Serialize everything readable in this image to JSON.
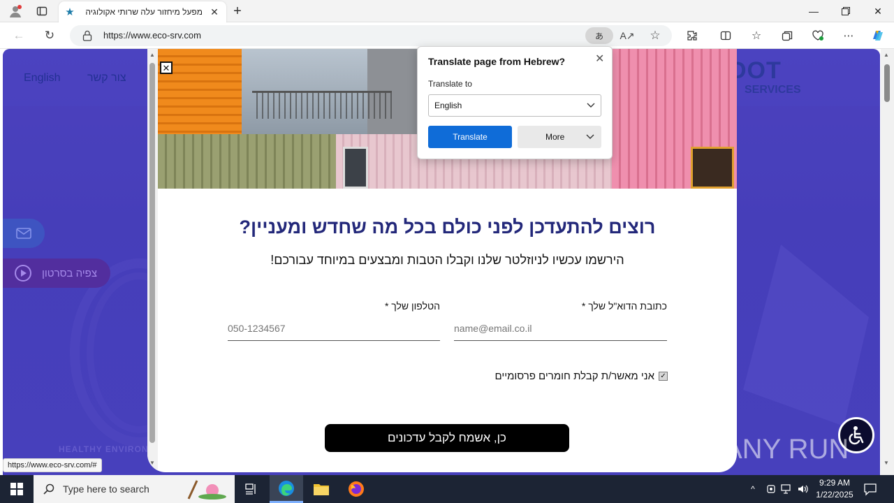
{
  "browser": {
    "tab_title": "מפעל מיחזור עלה שרותי אקולוגיה",
    "url": "https://www.eco-srv.com",
    "translate_badge": "あ",
    "status_url": "https://www.eco-srv.com/#"
  },
  "site": {
    "nav_english": "English",
    "nav_contact": "צור קשר",
    "logo_text": "DOT",
    "logo_sub": "SERVICES",
    "video_button": "צפיה בסרטון",
    "background_caption": "HEALTHY ENVIRON"
  },
  "popup": {
    "close_glyph": "✕",
    "headline": "רוצים להתעדכן לפני כולם בכל מה שחדש ומעניין?",
    "subheadline": "הירשמו עכשיו לניוזלטר שלנו וקבלו הטבות ומבצעים במיוחד עבורכם!",
    "email_label": "כתובת הדוא\"ל שלך *",
    "email_placeholder": "name@email.co.il",
    "phone_label": "הטלפון שלך *",
    "phone_placeholder": "050-1234567",
    "consent_label": "אני מאשר/ת קבלת חומרים פרסומיים",
    "consent_checked": true,
    "submit_label": "כן, אשמח לקבל עדכונים"
  },
  "translate_panel": {
    "title": "Translate page from Hebrew?",
    "translate_to_label": "Translate to",
    "selected_language": "English",
    "translate_button": "Translate",
    "more_button": "More"
  },
  "watermark": {
    "text": "ANY RUN"
  },
  "taskbar": {
    "search_placeholder": "Type here to search",
    "time": "9:29 AM",
    "date": "1/22/2025"
  },
  "colors": {
    "site_bg": "#4b44c2",
    "headline": "#23287a",
    "translate_button": "#0f6cd8",
    "taskbar": "#1c2434"
  }
}
